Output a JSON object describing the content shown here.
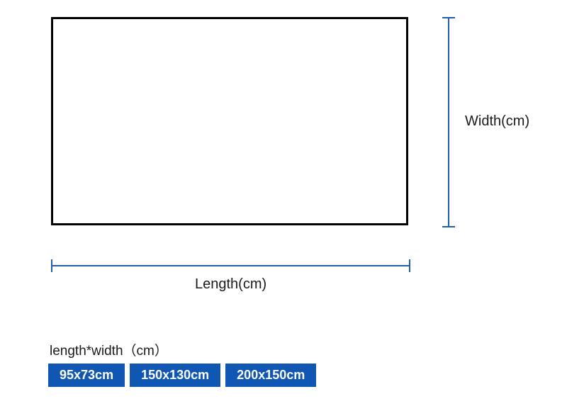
{
  "labels": {
    "width": "Width(cm)",
    "length": "Length(cm)",
    "sizeHeader": "length*width（cm）"
  },
  "sizeOptions": [
    "95x73cm",
    "150x130cm",
    "200x150cm"
  ]
}
